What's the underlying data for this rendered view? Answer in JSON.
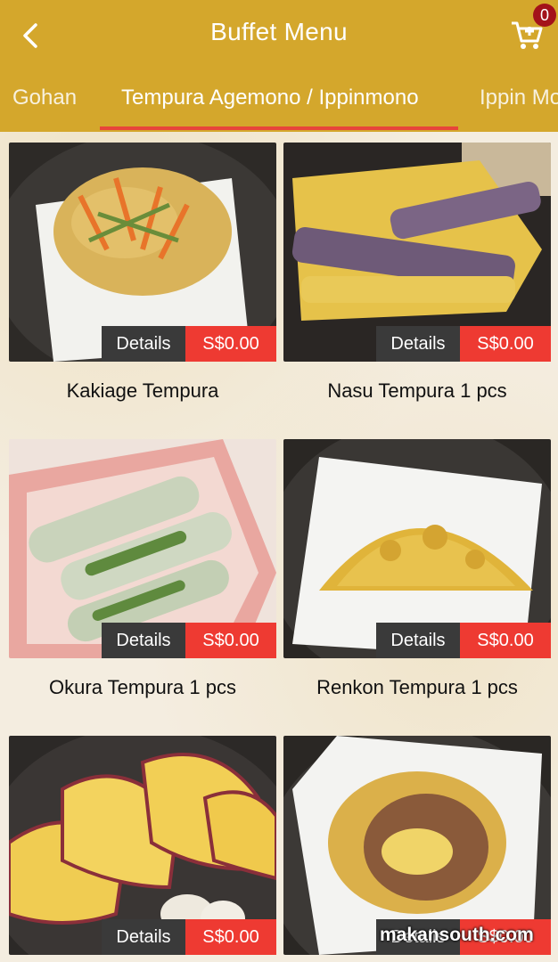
{
  "header": {
    "title": "Buffet Menu",
    "cart_count": "0"
  },
  "tabs": [
    {
      "label": "Gohan"
    },
    {
      "label": "Tempura Agemono / Ippinmono"
    },
    {
      "label": "Ippin Mo"
    }
  ],
  "items": [
    {
      "name": "Kakiage Tempura",
      "details_label": "Details",
      "price": "S$0.00"
    },
    {
      "name": "Nasu Tempura 1 pcs",
      "details_label": "Details",
      "price": "S$0.00"
    },
    {
      "name": "Okura Tempura 1 pcs",
      "details_label": "Details",
      "price": "S$0.00"
    },
    {
      "name": "Renkon Tempura 1 pcs",
      "details_label": "Details",
      "price": "S$0.00"
    },
    {
      "name": "",
      "details_label": "Details",
      "price": "S$0.00"
    },
    {
      "name": "",
      "details_label": "Details",
      "price": "S$0.00"
    }
  ],
  "watermark": "makansouth.com",
  "colors": {
    "header": "#d4a72c",
    "price": "#ee3a32",
    "details": "#3a3a3a",
    "badge": "#a3121a"
  }
}
